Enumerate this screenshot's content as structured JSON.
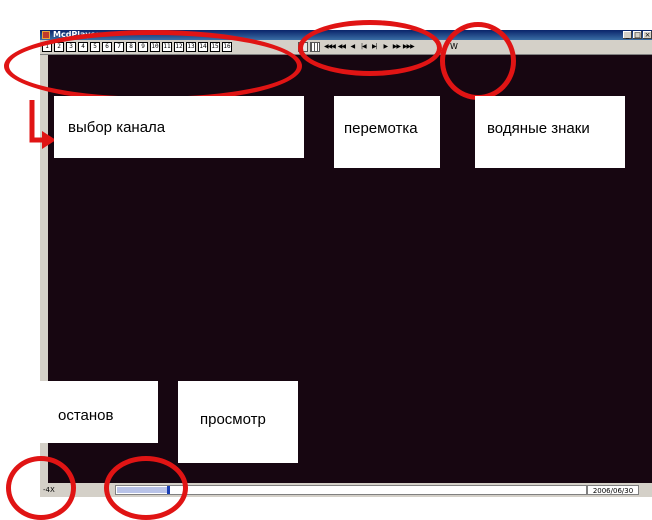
{
  "window": {
    "title": "McdPlayer",
    "controls": [
      "_",
      "□",
      "×"
    ]
  },
  "toolbar": {
    "channels": [
      "1",
      "2",
      "3",
      "4",
      "5",
      "6",
      "7",
      "8",
      "9",
      "10",
      "11",
      "12",
      "13",
      "14",
      "15",
      "16"
    ],
    "nav": [
      "◀◀◀",
      "◀◀",
      "◀",
      "|◀",
      "▶|",
      "▶",
      "▶▶",
      "▶▶▶"
    ],
    "watermark_label": "W"
  },
  "status": {
    "speed": "-4X",
    "progress": 0.11,
    "date": "2006/06/30"
  },
  "annotations": {
    "channel_select": "выбор канала",
    "rewind": "перемотка",
    "watermarks": "водяные знаки",
    "stop": "останов",
    "view": "просмотр"
  },
  "colors": {
    "annotation": "#e01414",
    "video_bg": "#170611",
    "title_bar": "#0a246a"
  }
}
